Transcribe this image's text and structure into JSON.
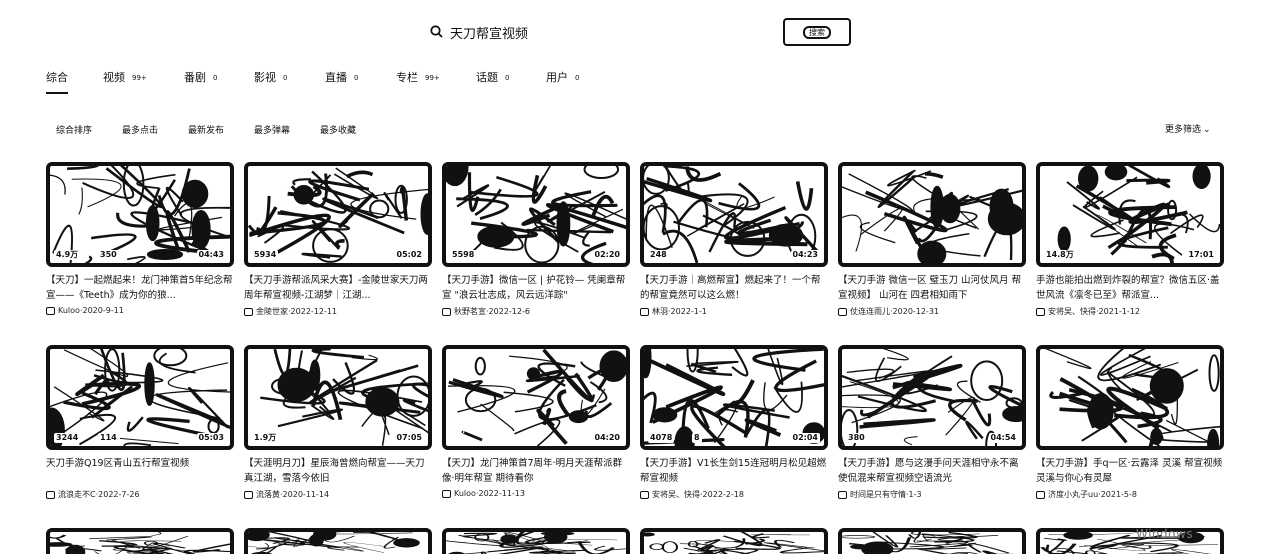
{
  "search": {
    "query": "天刀帮宣视频",
    "button_label": "搜索"
  },
  "tabs": [
    {
      "label": "综合",
      "count": ""
    },
    {
      "label": "视频",
      "count": "99+"
    },
    {
      "label": "番剧",
      "count": "0"
    },
    {
      "label": "影视",
      "count": "0"
    },
    {
      "label": "直播",
      "count": "0"
    },
    {
      "label": "专栏",
      "count": "99+"
    },
    {
      "label": "话题",
      "count": "0"
    },
    {
      "label": "用户",
      "count": "0"
    }
  ],
  "sorts": [
    "综合排序",
    "最多点击",
    "最新发布",
    "最多弹幕",
    "最多收藏"
  ],
  "more_filter": "更多筛选",
  "videos": [
    {
      "plays": "4.9万",
      "danmaku": "350",
      "duration": "04:43",
      "title": "【天刀】一起燃起来！龙门神策首5年纪念帮宣——《Teeth》成为你的狼...",
      "uploader": "Kuloo",
      "date": "2020-9-11"
    },
    {
      "plays": "5934",
      "danmaku": "",
      "duration": "05:02",
      "title": "【天刀手游帮派风采大赛】-金陵世家天刀两周年帮宣视频-江湖梦｜江湖...",
      "uploader": "金陵世家",
      "date": "2022-12-11"
    },
    {
      "plays": "5598",
      "danmaku": "",
      "duration": "02:20",
      "title": "【天刀手游】微信一区 | 护花铃— 凭阑章帮宣 \"浪云壮志成，风云远洋踪\"",
      "uploader": "秋野茗宣",
      "date": "2022-12-6"
    },
    {
      "plays": "248",
      "danmaku": "",
      "duration": "04:23",
      "title": "【天刀手游｜高燃帮宣】燃起来了！一个帮的帮宣竟然可以这么燃！",
      "uploader": "林羽",
      "date": "2022-1-1"
    },
    {
      "plays": "",
      "danmaku": "",
      "duration": "",
      "title": "【天刀手游 微信一区 璧玉刀 山河仗风月 帮宣视频】 山河在 四君相知雨下",
      "uploader": "仗连连雨儿",
      "date": "2020-12-31"
    },
    {
      "plays": "14.8万",
      "danmaku": "",
      "duration": "17:01",
      "title": "手游也能拍出燃到炸裂的帮宣？微信五区·盖世风流《凛冬已至》帮派宣...",
      "uploader": "安将吴、快得",
      "date": "2021-1-12"
    },
    {
      "plays": "3244",
      "danmaku": "114",
      "duration": "05:03",
      "title": "天刀手游Q19区青山五行帮宣视频",
      "uploader": "流浪走不C",
      "date": "2022-7-26"
    },
    {
      "plays": "1.9万",
      "danmaku": "",
      "duration": "07:05",
      "title": "【天涯明月刀】星辰海曾燃向帮宣——天刀真江湖，雪落今依旧",
      "uploader": "流落黄",
      "date": "2020-11-14"
    },
    {
      "plays": "",
      "danmaku": "",
      "duration": "04:20",
      "title": "【天刀】龙门神策首7周年·明月天涯帮派群像·明年帮宣 期待看你",
      "uploader": "Kuloo",
      "date": "2022-11-13"
    },
    {
      "plays": "4078",
      "danmaku": "8",
      "duration": "02:04",
      "title": "【天刀手游】V1长生剑15连冠明月松见超燃帮宣视频",
      "uploader": "安将吴、快得",
      "date": "2022-2-18"
    },
    {
      "plays": "380",
      "danmaku": "",
      "duration": "04:54",
      "title": "【天刀手游】愿与这漫手问天涯相守永不离 使侃混来帮宣视频空语流光",
      "uploader": "时间是只有守情",
      "date": "1-3"
    },
    {
      "plays": "",
      "danmaku": "",
      "duration": "",
      "title": "【天刀手游】手q一区·云露泽 灵溪 帮宣视频 灵溪与你心有灵犀",
      "uploader": "济度小丸子uu",
      "date": "2021-5-8"
    }
  ],
  "watermark": "Windows"
}
